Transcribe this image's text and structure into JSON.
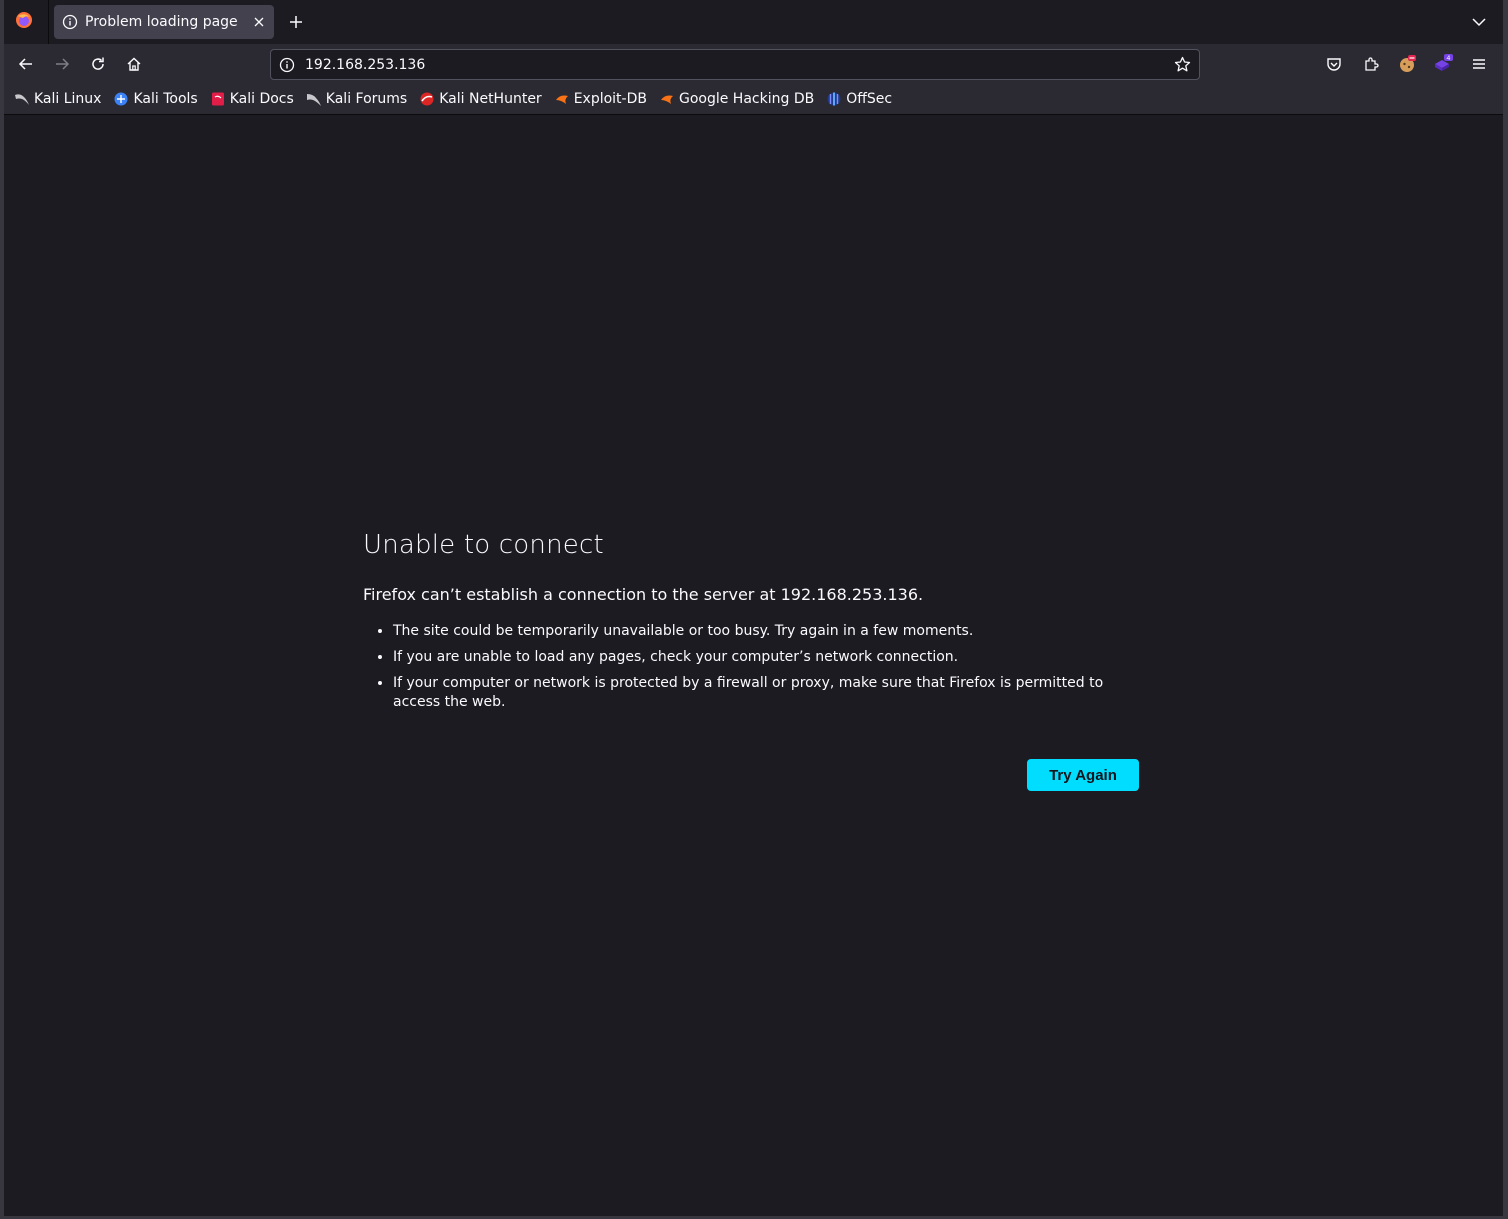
{
  "tab": {
    "title": "Problem loading page"
  },
  "urlbar": {
    "url": "192.168.253.136"
  },
  "bookmarks": [
    {
      "label": "Kali Linux",
      "icon": "kali-dragon-icon",
      "color": "#9aa0a6"
    },
    {
      "label": "Kali Tools",
      "icon": "kali-tools-icon",
      "color": "#3b82f6"
    },
    {
      "label": "Kali Docs",
      "icon": "kali-docs-icon",
      "color": "#e11d48"
    },
    {
      "label": "Kali Forums",
      "icon": "kali-forums-icon",
      "color": "#9aa0a6"
    },
    {
      "label": "Kali NetHunter",
      "icon": "nethunter-icon",
      "color": "#dc2626"
    },
    {
      "label": "Exploit-DB",
      "icon": "exploit-db-icon",
      "color": "#f97316"
    },
    {
      "label": "Google Hacking DB",
      "icon": "ghdb-icon",
      "color": "#f97316"
    },
    {
      "label": "OffSec",
      "icon": "offsec-icon",
      "color": "#6366f1"
    }
  ],
  "toolbar": {
    "container_badge": "4"
  },
  "error": {
    "title": "Unable to connect",
    "description": "Firefox can’t establish a connection to the server at 192.168.253.136.",
    "items": [
      "The site could be temporarily unavailable or too busy. Try again in a few moments.",
      "If you are unable to load any pages, check your computer’s network connection.",
      "If your computer or network is protected by a firewall or proxy, make sure that Firefox is permitted to access the web."
    ],
    "try_again_label": "Try Again"
  },
  "colors": {
    "accent": "#00ddff",
    "background": "#1c1b22",
    "toolbar": "#2b2a33"
  }
}
